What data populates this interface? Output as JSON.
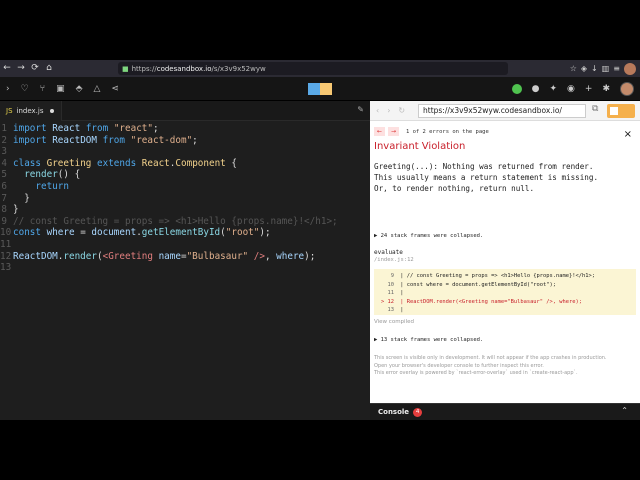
{
  "browser": {
    "url_prefix": "https://",
    "url_host": "codesandbox.io",
    "url_path": "/s/x3v9x52wyw",
    "nav_back": "←",
    "nav_forward": "→",
    "nav_reload": "⟳",
    "nav_home": "⌂"
  },
  "toolbar": {
    "logo_colors": [
      "#5aa9e6",
      "#f7c873"
    ],
    "icons_left": [
      "menu-icon",
      "heart-icon",
      "download-icon",
      "save-icon",
      "deploy-icon",
      "triangle-icon",
      "share-icon"
    ],
    "icons_right": [
      "github-icon",
      "twitter-icon",
      "eye-icon",
      "add-icon",
      "settings-icon",
      "user-avatar"
    ]
  },
  "editor": {
    "tab_icon": "JS",
    "tab_name": "index.js",
    "lines": [
      {
        "n": "1",
        "tokens": [
          [
            "kw",
            "import"
          ],
          [
            "txt",
            " "
          ],
          [
            "vr",
            "React"
          ],
          [
            "txt",
            " "
          ],
          [
            "kw",
            "from"
          ],
          [
            "txt",
            " "
          ],
          [
            "str",
            "\"react\""
          ],
          [
            "txt",
            ";"
          ]
        ]
      },
      {
        "n": "2",
        "tokens": [
          [
            "kw",
            "import"
          ],
          [
            "txt",
            " "
          ],
          [
            "vr",
            "ReactDOM"
          ],
          [
            "txt",
            " "
          ],
          [
            "kw",
            "from"
          ],
          [
            "txt",
            " "
          ],
          [
            "str",
            "\"react-dom\""
          ],
          [
            "txt",
            ";"
          ]
        ]
      },
      {
        "n": "3",
        "tokens": []
      },
      {
        "n": "4",
        "tokens": [
          [
            "kw",
            "class"
          ],
          [
            "txt",
            " "
          ],
          [
            "cls",
            "Greeting"
          ],
          [
            "txt",
            " "
          ],
          [
            "kw",
            "extends"
          ],
          [
            "txt",
            " "
          ],
          [
            "cls",
            "React"
          ],
          [
            "txt",
            "."
          ],
          [
            "cls",
            "Component"
          ],
          [
            "txt",
            " {"
          ]
        ]
      },
      {
        "n": "5",
        "tokens": [
          [
            "txt",
            "  "
          ],
          [
            "fn",
            "render"
          ],
          [
            "txt",
            "() {"
          ]
        ]
      },
      {
        "n": "6",
        "tokens": [
          [
            "txt",
            "    "
          ],
          [
            "kw",
            "return"
          ]
        ]
      },
      {
        "n": "7",
        "tokens": [
          [
            "txt",
            "  }"
          ]
        ]
      },
      {
        "n": "8",
        "tokens": [
          [
            "txt",
            "}"
          ]
        ]
      },
      {
        "n": "9",
        "tokens": [
          [
            "cm",
            "// const Greeting = props => <h1>Hello {props.name}!</h1>;"
          ]
        ]
      },
      {
        "n": "10",
        "tokens": [
          [
            "kw",
            "const"
          ],
          [
            "txt",
            " "
          ],
          [
            "vr",
            "where"
          ],
          [
            "txt",
            " = "
          ],
          [
            "vr",
            "document"
          ],
          [
            "txt",
            "."
          ],
          [
            "fn",
            "getElementById"
          ],
          [
            "txt",
            "("
          ],
          [
            "str",
            "\"root\""
          ],
          [
            "txt",
            ");"
          ]
        ]
      },
      {
        "n": "11",
        "tokens": []
      },
      {
        "n": "12",
        "tokens": [
          [
            "vr",
            "ReactDOM"
          ],
          [
            "txt",
            "."
          ],
          [
            "fn",
            "render"
          ],
          [
            "txt",
            "("
          ],
          [
            "tg",
            "<Greeting"
          ],
          [
            "txt",
            " "
          ],
          [
            "vr",
            "name"
          ],
          [
            "txt",
            "="
          ],
          [
            "str",
            "\"Bulbasaur\""
          ],
          [
            "txt",
            " "
          ],
          [
            "tg",
            "/>"
          ],
          [
            "txt",
            ", "
          ],
          [
            "vr",
            "where"
          ],
          [
            "txt",
            ");"
          ]
        ]
      },
      {
        "n": "13",
        "tokens": []
      }
    ]
  },
  "preview": {
    "url": "https://x3v9x52wyw.codesandbox.io/",
    "error": {
      "counter": "1 of 2 errors on the page",
      "title": "Invariant Violation",
      "message": "Greeting(...): Nothing was returned from render.\nThis usually means a return statement is missing.\nOr, to render nothing, return null.",
      "collapsed_top": "▶ 24 stack frames were collapsed.",
      "fn_name": "evaluate",
      "file": "/index.js:12",
      "snippet": [
        {
          "n": "9",
          "text": "| // const Greeting = props => <h1>Hello {props.name}!</h1>;",
          "hl": false
        },
        {
          "n": "10",
          "text": "| const where = document.getElementById(\"root\");",
          "hl": false
        },
        {
          "n": "11",
          "text": "|",
          "hl": false
        },
        {
          "n": "> 12",
          "text": "| ReactDOM.render(<Greeting name=\"Bulbasaur\" />, where);",
          "hl": true
        },
        {
          "n": "13",
          "text": "|",
          "hl": false
        }
      ],
      "view_compiled": "View compiled",
      "collapsed_bottom": "▶ 13 stack frames were collapsed.",
      "footer": [
        "This screen is visible only in development. It will not appear if the app crashes in production.",
        "Open your browser's developer console to further inspect this error.",
        "This error overlay is powered by `react-error-overlay` used in `create-react-app`."
      ]
    },
    "console_label": "Console",
    "console_count": "4"
  }
}
